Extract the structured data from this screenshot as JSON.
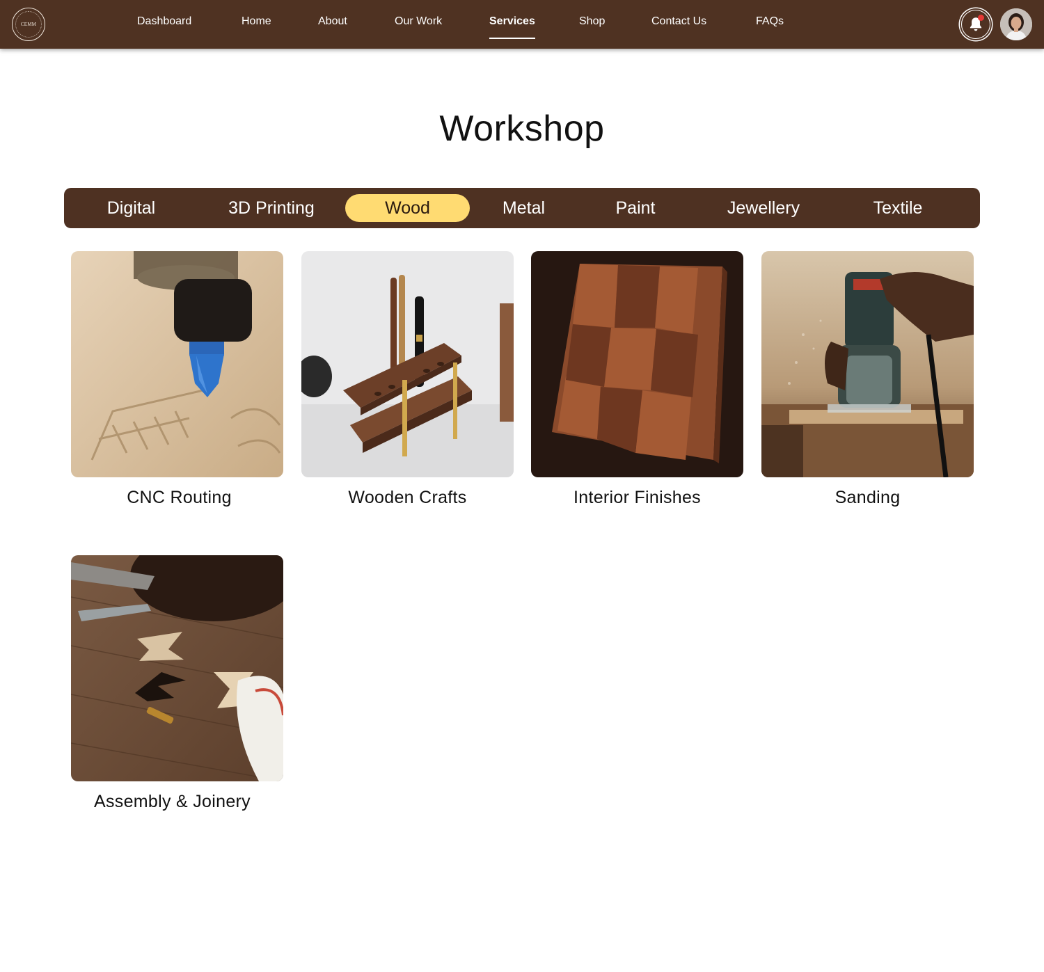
{
  "nav": {
    "logo_text": "CEMM",
    "items": [
      {
        "label": "Dashboard"
      },
      {
        "label": "Home"
      },
      {
        "label": "About"
      },
      {
        "label": "Our Work"
      },
      {
        "label": "Services",
        "active": true
      },
      {
        "label": "Shop"
      },
      {
        "label": "Contact Us"
      },
      {
        "label": "FAQs"
      }
    ],
    "notification_icon": "bell-icon",
    "has_unread": true
  },
  "page": {
    "title": "Workshop"
  },
  "categories": {
    "items": [
      {
        "label": "Digital"
      },
      {
        "label": "3D Printing"
      },
      {
        "label": "Wood",
        "active": true
      },
      {
        "label": "Metal"
      },
      {
        "label": "Paint"
      },
      {
        "label": "Jewellery"
      },
      {
        "label": "Textile"
      }
    ]
  },
  "services": [
    {
      "label": "CNC Routing"
    },
    {
      "label": "Wooden Crafts"
    },
    {
      "label": "Interior Finishes"
    },
    {
      "label": "Sanding"
    },
    {
      "label": "Assembly & Joinery"
    }
  ],
  "colors": {
    "nav_bg": "#4f3222",
    "category_bar_bg": "#4e3122",
    "category_active_bg": "#ffdb72",
    "notification_dot": "#e53935"
  }
}
